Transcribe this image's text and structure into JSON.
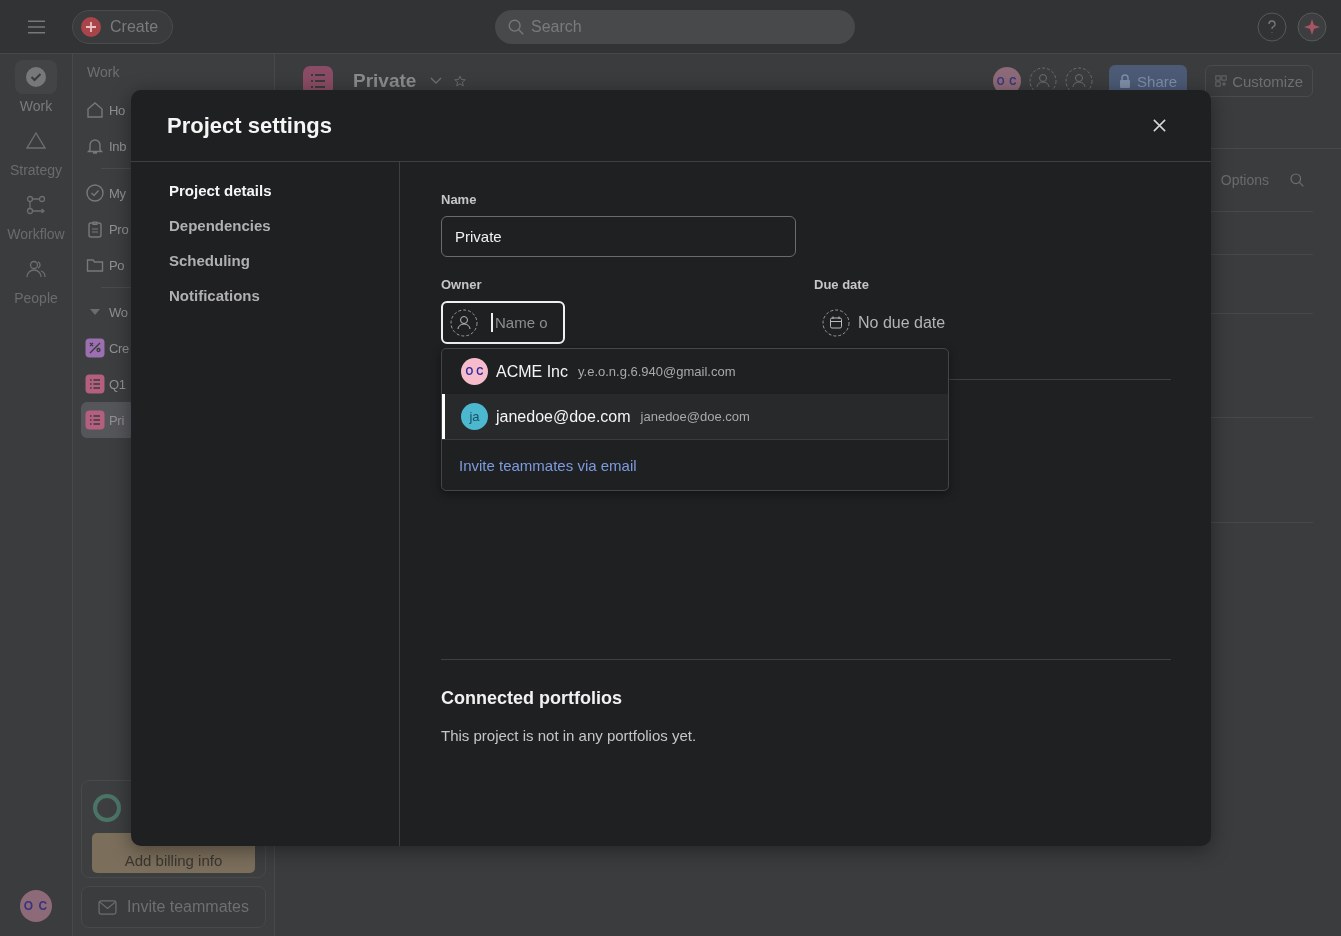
{
  "topbar": {
    "create_label": "Create",
    "search": {
      "placeholder": "Search"
    }
  },
  "rail": [
    {
      "label": "Work",
      "kind": "check",
      "selected": true
    },
    {
      "label": "Strategy",
      "kind": "triangle",
      "selected": false
    },
    {
      "label": "Workflow",
      "kind": "flow",
      "selected": false
    },
    {
      "label": "People",
      "kind": "people",
      "selected": false
    }
  ],
  "rail_avatar": {
    "initials": "O C"
  },
  "sidebar": {
    "heading": "Work",
    "items": [
      {
        "label": "Ho",
        "kind": "home",
        "selected": false
      },
      {
        "label": "Inb",
        "kind": "bell",
        "selected": false
      },
      {
        "label": "My",
        "kind": "check",
        "selected": false
      },
      {
        "label": "Pro",
        "kind": "clipboard",
        "selected": false
      },
      {
        "label": "Po",
        "kind": "folder",
        "selected": false
      },
      {
        "label": "Wo",
        "kind": "caret",
        "selected": false
      },
      {
        "label": "Cre",
        "kind": "project",
        "color": "#9b6fb0",
        "selected": false
      },
      {
        "label": "Q1",
        "kind": "list",
        "color": "#b45f7e",
        "selected": false
      },
      {
        "label": "Pri",
        "kind": "list",
        "color": "#b45f7e",
        "selected": true
      }
    ],
    "billing_button": "Add billing info",
    "invite_button": "Invite teammates"
  },
  "project_header": {
    "title": "Private",
    "avatar_initials": "O C",
    "share": "Share",
    "customize": "Customize",
    "options": "Options"
  },
  "dialog": {
    "title": "Project settings",
    "nav": [
      {
        "label": "Project details",
        "selected": true
      },
      {
        "label": "Dependencies",
        "selected": false
      },
      {
        "label": "Scheduling",
        "selected": false
      },
      {
        "label": "Notifications",
        "selected": false
      }
    ],
    "name": {
      "label": "Name",
      "value": "Private"
    },
    "owner": {
      "label": "Owner",
      "placeholder": "Name o"
    },
    "due_date": {
      "label": "Due date",
      "value": "No due date"
    },
    "owner_menu": {
      "options": [
        {
          "name": "ACME Inc",
          "email": "y.e.o.n.g.6.940@gmail.com",
          "avatar": "O C",
          "color": "#f6bccb",
          "selected": false
        },
        {
          "name": "janedoe@doe.com",
          "email": "janedoe@doe.com",
          "avatar": "ja",
          "color": "#4cb8d0",
          "selected": true
        }
      ],
      "invite_link": "Invite teammates via email"
    },
    "portfolios": {
      "heading": "Connected portfolios",
      "text": "This project is not in any portfolios yet."
    }
  }
}
